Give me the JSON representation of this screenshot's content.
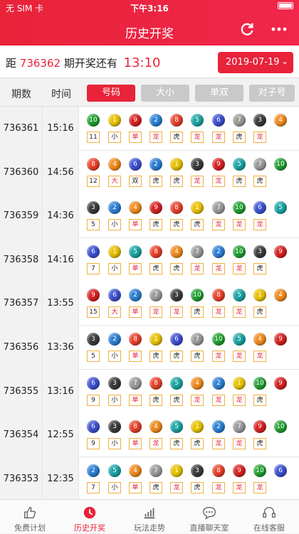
{
  "status": {
    "carrier": "无 SIM 卡",
    "time": "下午3:16"
  },
  "header": {
    "title": "历史开奖"
  },
  "topbar": {
    "prefix": "距 ",
    "issue": "736362",
    "mid": " 期开奖还有",
    "countdown": "13:10",
    "date": "2019-07-19"
  },
  "columns": {
    "issue": "期数",
    "time": "时间"
  },
  "tabs": [
    {
      "label": "号码",
      "active": true
    },
    {
      "label": "大小",
      "active": false
    },
    {
      "label": "单双",
      "active": false
    },
    {
      "label": "对子号",
      "active": false
    }
  ],
  "colors": {
    "1": "#e8c200",
    "2": "#2b7fd4",
    "3": "#3a3a3a",
    "4": "#f08a1c",
    "5": "#1aa4a4",
    "6": "#3c4fd0",
    "7": "#9a9a9a",
    "8": "#e8402a",
    "9": "#d62020",
    "10": "#1e9e2e"
  },
  "rows": [
    {
      "issue": "736361",
      "time": "15:16",
      "balls": [
        10,
        1,
        9,
        2,
        8,
        5,
        6,
        7,
        3,
        4
      ],
      "sum": "11",
      "tags": [
        "小",
        "单",
        "龙",
        "虎",
        "龙",
        "龙",
        "虎",
        "龙"
      ]
    },
    {
      "issue": "736360",
      "time": "14:56",
      "balls": [
        8,
        4,
        6,
        2,
        1,
        3,
        9,
        5,
        7,
        10
      ],
      "sum": "12",
      "tags": [
        "大",
        "双",
        "虎",
        "虎",
        "龙",
        "龙",
        "虎",
        "虎"
      ]
    },
    {
      "issue": "736359",
      "time": "14:36",
      "balls": [
        3,
        2,
        4,
        9,
        8,
        1,
        7,
        10,
        6,
        5
      ],
      "sum": "5",
      "tags": [
        "小",
        "单",
        "虎",
        "虎",
        "虎",
        "龙",
        "龙",
        "龙"
      ]
    },
    {
      "issue": "736358",
      "time": "14:16",
      "balls": [
        6,
        1,
        5,
        8,
        4,
        7,
        2,
        10,
        3,
        9
      ],
      "sum": "7",
      "tags": [
        "小",
        "单",
        "虎",
        "虎",
        "龙",
        "龙",
        "龙",
        "虎"
      ]
    },
    {
      "issue": "736357",
      "time": "13:55",
      "balls": [
        9,
        6,
        2,
        7,
        3,
        10,
        8,
        5,
        1,
        4
      ],
      "sum": "15",
      "tags": [
        "大",
        "单",
        "龙",
        "龙",
        "虎",
        "龙",
        "龙",
        "虎"
      ]
    },
    {
      "issue": "736356",
      "time": "13:36",
      "balls": [
        3,
        2,
        8,
        1,
        6,
        7,
        10,
        5,
        4,
        9
      ],
      "sum": "5",
      "tags": [
        "小",
        "单",
        "虎",
        "虎",
        "虎",
        "龙",
        "龙",
        "龙"
      ]
    },
    {
      "issue": "736355",
      "time": "13:16",
      "balls": [
        6,
        3,
        7,
        8,
        5,
        4,
        2,
        1,
        10,
        9
      ],
      "sum": "9",
      "tags": [
        "小",
        "单",
        "虎",
        "虎",
        "龙",
        "龙",
        "龙",
        "虎"
      ]
    },
    {
      "issue": "736354",
      "time": "12:55",
      "balls": [
        6,
        3,
        8,
        4,
        5,
        1,
        2,
        7,
        9,
        10
      ],
      "sum": "9",
      "tags": [
        "小",
        "单",
        "龙",
        "虎",
        "虎",
        "龙",
        "龙",
        "虎"
      ]
    },
    {
      "issue": "736353",
      "time": "12:35",
      "balls": [
        2,
        5,
        4,
        7,
        1,
        3,
        8,
        9,
        10,
        6
      ],
      "sum": "7",
      "tags": [
        "小",
        "单",
        "虎",
        "龙",
        "虎",
        "龙",
        "龙",
        "龙"
      ]
    }
  ],
  "nav": [
    {
      "label": "免费计划",
      "icon": "thumbs-up-icon",
      "active": false
    },
    {
      "label": "历史开奖",
      "icon": "clock-icon",
      "active": true
    },
    {
      "label": "玩法走势",
      "icon": "bar-chart-icon",
      "active": false
    },
    {
      "label": "直播聊天室",
      "icon": "chat-bubble-icon",
      "active": false
    },
    {
      "label": "在线客服",
      "icon": "headset-icon",
      "active": false
    }
  ]
}
